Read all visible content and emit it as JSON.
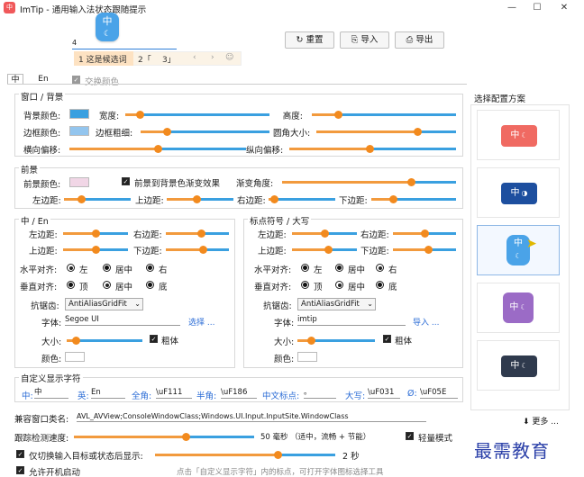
{
  "window": {
    "title": "ImTip - 通用输入法状态跟随提示",
    "controls": [
      "—",
      "☐",
      "✕"
    ]
  },
  "preview": {
    "badge_char": "中",
    "badge_mode": "☾",
    "input_value": "4",
    "candidates": [
      "1 这是候选词",
      "2「",
      "3」"
    ],
    "nav": [
      "‹",
      "›",
      "☺"
    ]
  },
  "toolbar": {
    "reset_label": "重置",
    "import_label": "导入",
    "export_label": "导出",
    "reset_icon": "↻",
    "import_icon": "⎘",
    "export_icon": "⎙"
  },
  "tabs": {
    "zh": "中",
    "en": "En",
    "swap_colors_label": "交换颜色"
  },
  "window_bg": {
    "title": "窗口 / 背景",
    "bg_color_label": "背景颜色:",
    "bg_color": "#3aa0e0",
    "width_label": "宽度:",
    "width_value": 0.1,
    "height_label": "高度:",
    "height_value": 0.18,
    "border_color_label": "边框颜色:",
    "border_color": "#93c5ee",
    "border_width_label": "边框粗细:",
    "border_width_value": 0.2,
    "corner_label": "圆角大小:",
    "corner_value": 0.72,
    "hoffset_label": "横向偏移:",
    "hoffset_value": 0.5,
    "voffset_label": "纵向偏移:",
    "voffset_value": 0.48
  },
  "foreground": {
    "title": "前景",
    "fg_color_label": "前景颜色:",
    "fg_color": "#f1d6e6",
    "gradient_checkbox_label": "前景到背景色渐变效果",
    "gradient_checked": true,
    "gradient_angle_label": "渐变角度:",
    "gradient_angle_value": 0.74,
    "left_label": "左边距:",
    "left_value": 0.25,
    "top_label": "上边距:",
    "top_value": 0.45,
    "right_label": "右边距:",
    "right_value": 0.08,
    "bottom_label": "下边距:",
    "bottom_value": 0.25
  },
  "zh_en": {
    "title": "中 / En",
    "left_label": "左边距:",
    "left_value": 0.5,
    "right_label": "右边距:",
    "right_value": 0.55,
    "top_label": "上边距:",
    "top_value": 0.5,
    "bottom_label": "下边距:",
    "bottom_value": 0.58,
    "halign_label": "水平对齐:",
    "halign_options": [
      "左",
      "居中",
      "右"
    ],
    "halign_selected": 0,
    "valign_label": "垂直对齐:",
    "valign_options": [
      "顶",
      "居中",
      "底"
    ],
    "valign_selected": 1,
    "antialias_label": "抗锯齿:",
    "antialias_value": "AntiAliasGridFit",
    "font_label": "字体:",
    "font_value": "Segoe UI",
    "choose_label": "选择 ...",
    "size_label": "大小:",
    "size_value": 0.12,
    "bold_label": "粗体",
    "bold_checked": true,
    "color_label": "颜色:"
  },
  "punct": {
    "title": "标点符号 / 大写",
    "left_label": "左边距:",
    "left_value": 0.5,
    "right_label": "右边距:",
    "right_value": 0.5,
    "top_label": "上边距:",
    "top_value": 0.55,
    "bottom_label": "下边距:",
    "bottom_value": 0.55,
    "halign_label": "水平对齐:",
    "halign_options": [
      "左",
      "居中",
      "右"
    ],
    "halign_selected": 2,
    "valign_label": "垂直对齐:",
    "valign_options": [
      "顶",
      "居中",
      "底"
    ],
    "valign_selected": 1,
    "antialias_label": "抗锯齿:",
    "antialias_value": "AntiAliasGridFit",
    "font_label": "字体:",
    "font_value": "imtip",
    "import_label": "导入 ...",
    "size_label": "大小:",
    "size_value": 0.18,
    "bold_label": "粗体",
    "bold_checked": true,
    "color_label": "颜色:"
  },
  "custom_display": {
    "title": "自定义显示字符",
    "zh_label": "中:",
    "zh_value": "中",
    "en_label": "英:",
    "en_value": "En",
    "full_label": "全角:",
    "full_value": "\\uF111",
    "half_label": "半角:",
    "half_value": "\\uF186",
    "cnpunct_label": "中文标点:",
    "cnpunct_value": "。",
    "caps_label": "大写:",
    "caps_value": "\\uF031",
    "ascii_label": "Ø:",
    "ascii_value": "\\uF05E"
  },
  "schemes": {
    "title": "选择配置方案",
    "more_label": "更多 ...",
    "cards": [
      {
        "char": "中",
        "mode": "☾",
        "bg": "#f06a62",
        "selected": false
      },
      {
        "char": "中",
        "mode": "◑",
        "bg": "#1d4f9f",
        "selected": false
      },
      {
        "char": "中",
        "mode": "☾",
        "bg": "#4aa3e8",
        "selected": true
      },
      {
        "char": "中",
        "mode": "☾",
        "bg": "#9b6bc6",
        "selected": false
      },
      {
        "char": "中",
        "mode": "☾",
        "bg": "#2f3a4d",
        "selected": false
      }
    ]
  },
  "bottom": {
    "compat_label": "兼容窗口类名:",
    "compat_value": "AVL_AVView;ConsoleWindowClass;Windows.UI.Input.InputSite.WindowClass",
    "track_label": "跟踪检测速度:",
    "track_value": 0.62,
    "track_text": "50 毫秒 （适中，流畅 + 节能）",
    "light_label": "轻量模式",
    "light_checked": true,
    "switch_label": "仅切换输入目标或状态后显示:",
    "switch_checked": true,
    "switch_value": 0.68,
    "switch_text": "2 秒",
    "startup_label": "允许开机启动",
    "startup_checked": true,
    "hint": "点击「自定义显示字符」内的标点，可打开字体图标选择工具"
  },
  "watermark": "最需教育"
}
